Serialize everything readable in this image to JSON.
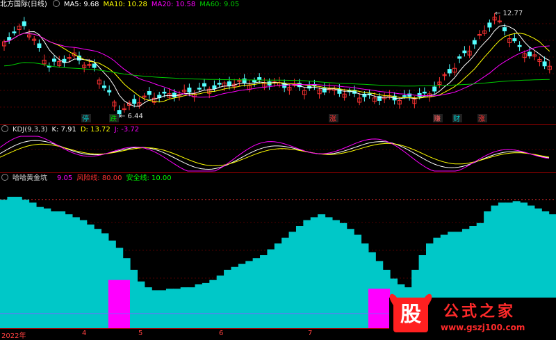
{
  "header": {
    "title": "北方国际(日线)",
    "ma5": "MA5: 9.68",
    "ma10": "MA10: 10.28",
    "ma20": "MA20: 10.58",
    "ma60": "MA60: 9.05"
  },
  "kdj_header": {
    "title": "KDJ(9,3,3)",
    "k": "K: 7.91",
    "d": "D: 13.72",
    "j": "J: -3.72"
  },
  "ind_header": {
    "title": "哈哈黄金坑",
    "value": "9.05",
    "risk": "风险线: 80.00",
    "safe": "安全线: 10.00"
  },
  "colors": {
    "up": "#ff3232",
    "down": "#54ffff",
    "ma5": "#ffffff",
    "ma10": "#ffff00",
    "ma20": "#ff00ff",
    "ma60": "#00cc00",
    "fill": "#00c8c8",
    "pit": "#ff00ff",
    "grid": "#8b0000"
  },
  "chart_data": {
    "type": "candlestick",
    "price_annotations": [
      {
        "label": "12.77",
        "kind": "high"
      },
      {
        "label": "6.44",
        "kind": "low"
      }
    ],
    "signal_markers": [
      "停",
      "跌",
      "涨",
      "赚",
      "财",
      "涨"
    ],
    "x_ticks": [
      "2022年",
      "4",
      "5",
      "6",
      "7"
    ],
    "indicator_levels": {
      "risk": 80,
      "safe": 10
    },
    "indicator_current": 9.05,
    "indicator_series": [
      88,
      90,
      90,
      88,
      86,
      83,
      82,
      80,
      80,
      78,
      76,
      74,
      71,
      68,
      65,
      60,
      55,
      48,
      40,
      32,
      28,
      26,
      26,
      27,
      27,
      28,
      28,
      30,
      31,
      33,
      36,
      40,
      42,
      44,
      46,
      48,
      50,
      54,
      58,
      62,
      66,
      70,
      74,
      76,
      78,
      76,
      74,
      72,
      68,
      64,
      58,
      52,
      46,
      40,
      34,
      30,
      28,
      40,
      50,
      58,
      62,
      64,
      66,
      66,
      68,
      70,
      72,
      80,
      84,
      86,
      86,
      87,
      86,
      84,
      82,
      80,
      78
    ],
    "pit_segments": [
      {
        "from": 15,
        "to": 17,
        "value": 33
      },
      {
        "from": 51,
        "to": 53,
        "value": 27
      }
    ],
    "kdj_last": {
      "K": 7.91,
      "D": 13.72,
      "J": -3.72
    }
  }
}
